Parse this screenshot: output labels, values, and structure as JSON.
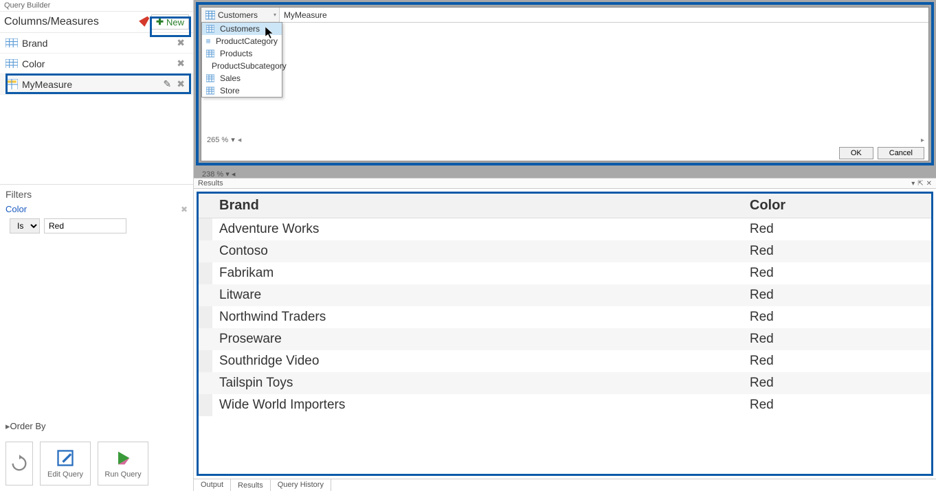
{
  "leftPanel": {
    "title": "Query Builder",
    "sectionTitle": "Columns/Measures",
    "newButton": "New",
    "columns": [
      {
        "label": "Brand",
        "type": "col"
      },
      {
        "label": "Color",
        "type": "col"
      },
      {
        "label": "MyMeasure",
        "type": "measure"
      }
    ],
    "filtersTitle": "Filters",
    "filter": {
      "name": "Color",
      "op": "Is",
      "value": "Red"
    },
    "orderByTitle": "Order By",
    "buttons": {
      "editQuery": "Edit Query",
      "runQuery": "Run Query"
    }
  },
  "editor": {
    "tableDropdown": {
      "selected": "Customers",
      "options": [
        "Customers",
        "ProductCategory",
        "Products",
        "ProductSubcategory",
        "Sales",
        "Store"
      ],
      "highlighted": "Customers"
    },
    "formula": "MyMeasure",
    "zoom": "265 %",
    "zoom2": "238 %",
    "okButton": "OK",
    "cancelButton": "Cancel"
  },
  "results": {
    "title": "Results",
    "columns": [
      "Brand",
      "Color"
    ],
    "rows": [
      [
        "Adventure Works",
        "Red"
      ],
      [
        "Contoso",
        "Red"
      ],
      [
        "Fabrikam",
        "Red"
      ],
      [
        "Litware",
        "Red"
      ],
      [
        "Northwind Traders",
        "Red"
      ],
      [
        "Proseware",
        "Red"
      ],
      [
        "Southridge Video",
        "Red"
      ],
      [
        "Tailspin Toys",
        "Red"
      ],
      [
        "Wide World Importers",
        "Red"
      ]
    ]
  },
  "bottomTabs": [
    "Output",
    "Results",
    "Query History"
  ]
}
